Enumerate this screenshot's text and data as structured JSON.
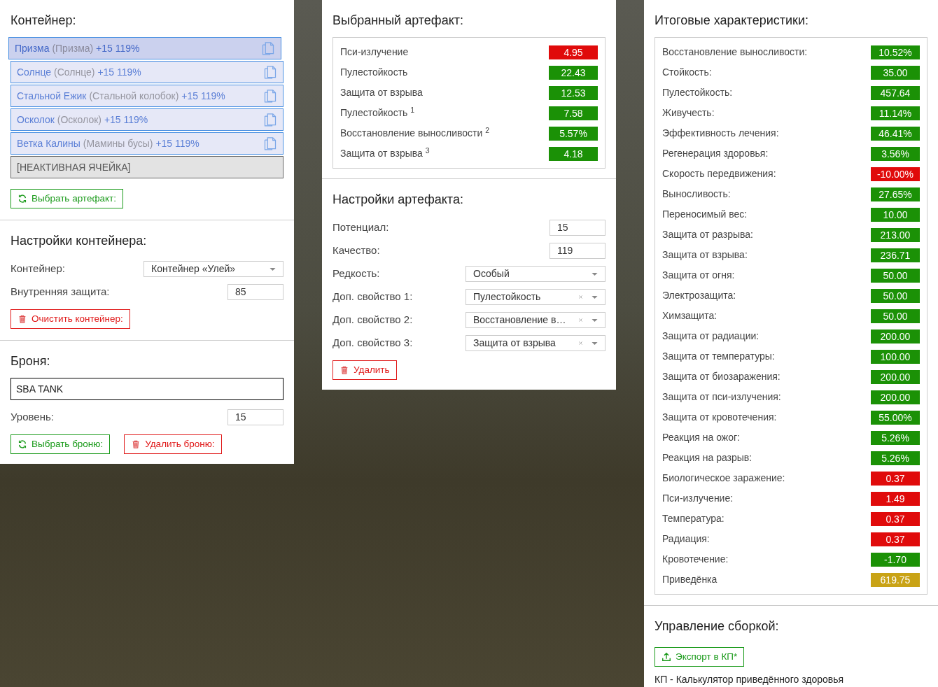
{
  "container": {
    "title": "Контейнер:",
    "slots": [
      {
        "kind": "artifact",
        "name": "Призма",
        "alias": "(Призма)",
        "bonus": "+15 119%",
        "selected": true
      },
      {
        "kind": "artifact",
        "name": "Солнце",
        "alias": "(Солнце)",
        "bonus": "+15 119%",
        "selected": false
      },
      {
        "kind": "artifact",
        "name": "Стальной Ежик",
        "alias": "(Стальной колобок)",
        "bonus": "+15 119%",
        "selected": false
      },
      {
        "kind": "artifact",
        "name": "Осколок",
        "alias": "(Осколок)",
        "bonus": "+15 119%",
        "selected": false
      },
      {
        "kind": "artifact",
        "name": "Ветка Калины",
        "alias": "(Мамины бусы)",
        "bonus": "+15 119%",
        "selected": false
      },
      {
        "kind": "inactive",
        "name": "[НЕАКТИВНАЯ ЯЧЕЙКА]"
      }
    ],
    "choose_button": "Выбрать артефакт:"
  },
  "container_settings": {
    "title": "Настройки контейнера:",
    "fields": [
      {
        "kind": "select",
        "label": "Контейнер:",
        "value": "Контейнер «Улей»"
      },
      {
        "kind": "number",
        "label": "Внутренняя защита:",
        "value": "85"
      }
    ],
    "clear_button": "Очистить контейнер:"
  },
  "armor": {
    "title": "Броня:",
    "name": "SBA TANK",
    "level_label": "Уровень:",
    "level_value": "15",
    "choose_button": "Выбрать броню:",
    "delete_button": "Удалить броню:"
  },
  "selected_artifact": {
    "title": "Выбранный артефакт:",
    "stats": [
      {
        "label": "Пси-излучение",
        "value": "4.95",
        "color": "#e00b0b"
      },
      {
        "label": "Пулестойкость",
        "value": "22.43",
        "color": "#1b9106"
      },
      {
        "label": "Защита от взрыва",
        "value": "12.53",
        "color": "#1b9106"
      },
      {
        "label": "Пулестойкость $^{1}$",
        "value": "7.58",
        "color": "#1b9106"
      },
      {
        "label": "Восстановление выносливости $^{2}$",
        "value": "5.57%",
        "color": "#1b9106"
      },
      {
        "label": "Защита от взрыва $^{3}$",
        "value": "4.18",
        "color": "#1b9106"
      }
    ]
  },
  "artifact_settings": {
    "title": "Настройки артефакта:",
    "fields": [
      {
        "kind": "number",
        "label": "Потенциал:",
        "value": "15"
      },
      {
        "kind": "number",
        "label": "Качество:",
        "value": "119"
      },
      {
        "kind": "select",
        "label": "Редкость:",
        "value": "Особый",
        "clearable": false
      },
      {
        "kind": "select",
        "label": "Доп. свойство 1:",
        "value": "Пулестойкость",
        "clearable": true
      },
      {
        "kind": "select",
        "label": "Доп. свойство 2:",
        "value": "Восстановление в…",
        "clearable": true
      },
      {
        "kind": "select",
        "label": "Доп. свойство 3:",
        "value": "Защита от взрыва",
        "clearable": true
      }
    ],
    "delete_button": "Удалить"
  },
  "totals": {
    "title": "Итоговые характеристики:",
    "stats": [
      {
        "label": "Восстановление выносливости:",
        "value": "10.52%",
        "color": "#1b9106"
      },
      {
        "label": "Стойкость:",
        "value": "35.00",
        "color": "#1b9106"
      },
      {
        "label": "Пулестойкость:",
        "value": "457.64",
        "color": "#1b9106"
      },
      {
        "label": "Живучесть:",
        "value": "11.14%",
        "color": "#1b9106"
      },
      {
        "label": "Эффективность лечения:",
        "value": "46.41%",
        "color": "#1b9106"
      },
      {
        "label": "Регенерация здоровья:",
        "value": "3.56%",
        "color": "#1b9106"
      },
      {
        "label": "Скорость передвижения:",
        "value": "-10.00%",
        "color": "#e00b0b"
      },
      {
        "label": "Выносливость:",
        "value": "27.65%",
        "color": "#1b9106"
      },
      {
        "label": "Переносимый вес:",
        "value": "10.00",
        "color": "#1b9106"
      },
      {
        "label": "Защита от разрыва:",
        "value": "213.00",
        "color": "#1b9106"
      },
      {
        "label": "Защита от взрыва:",
        "value": "236.71",
        "color": "#1b9106"
      },
      {
        "label": "Защита от огня:",
        "value": "50.00",
        "color": "#1b9106"
      },
      {
        "label": "Электрозащита:",
        "value": "50.00",
        "color": "#1b9106"
      },
      {
        "label": "Химзащита:",
        "value": "50.00",
        "color": "#1b9106"
      },
      {
        "label": "Защита от радиации:",
        "value": "200.00",
        "color": "#1b9106"
      },
      {
        "label": "Защита от температуры:",
        "value": "100.00",
        "color": "#1b9106"
      },
      {
        "label": "Защита от биозаражения:",
        "value": "200.00",
        "color": "#1b9106"
      },
      {
        "label": "Защита от пси-излучения:",
        "value": "200.00",
        "color": "#1b9106"
      },
      {
        "label": "Защита от кровотечения:",
        "value": "55.00%",
        "color": "#1b9106"
      },
      {
        "label": "Реакция на ожог:",
        "value": "5.26%",
        "color": "#1b9106"
      },
      {
        "label": "Реакция на разрыв:",
        "value": "5.26%",
        "color": "#1b9106"
      },
      {
        "label": "Биологическое заражение:",
        "value": "0.37",
        "color": "#e00b0b"
      },
      {
        "label": "Пси-излучение:",
        "value": "1.49",
        "color": "#e00b0b"
      },
      {
        "label": "Температура:",
        "value": "0.37",
        "color": "#e00b0b"
      },
      {
        "label": "Радиация:",
        "value": "0.37",
        "color": "#e00b0b"
      },
      {
        "label": "Кровотечение:",
        "value": "-1.70",
        "color": "#1b9106"
      },
      {
        "label": "Приведёнка",
        "value": "619.75",
        "color": "#c9a316"
      }
    ]
  },
  "build": {
    "title": "Управление сборкой:",
    "export_button": "Экспорт в КП*",
    "footnote": "КП - Калькулятор приведённого здоровья"
  }
}
